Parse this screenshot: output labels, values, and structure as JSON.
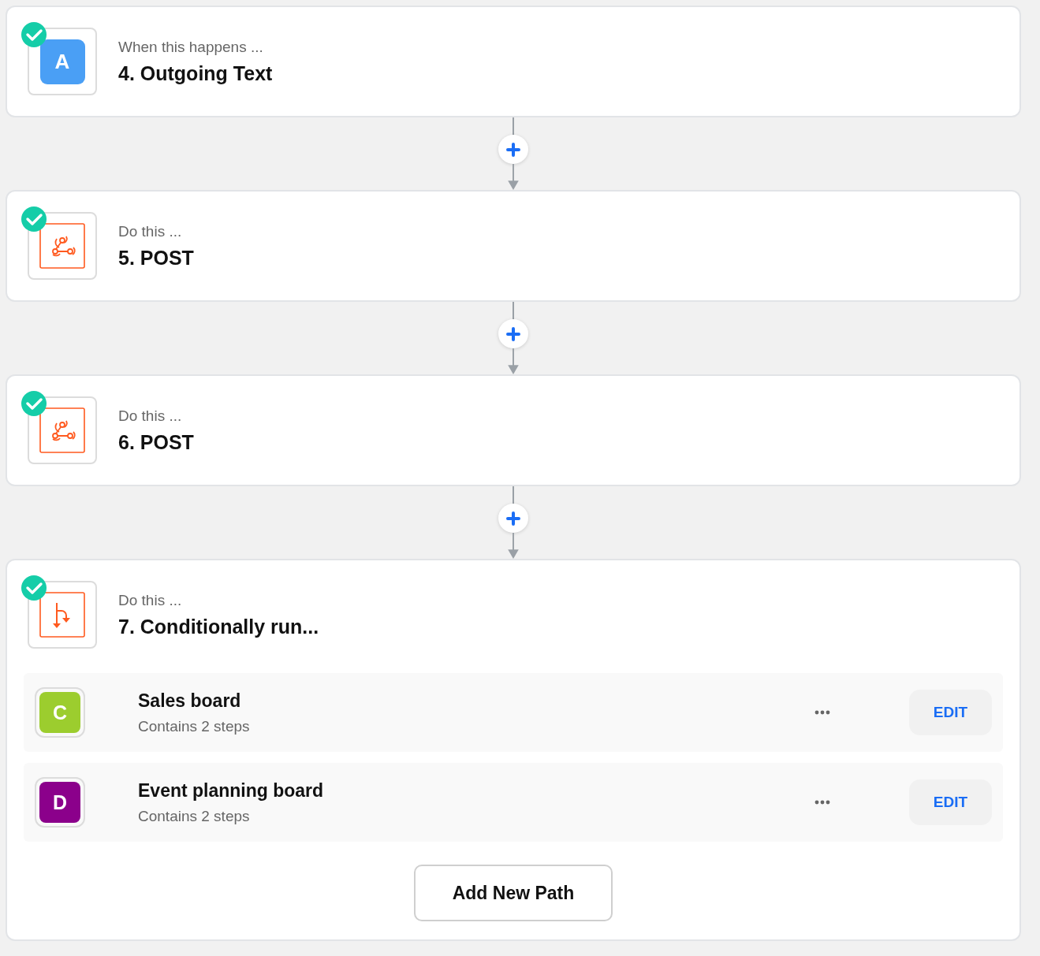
{
  "steps": [
    {
      "kind": "app",
      "done": true,
      "letter": "A",
      "color": "#4a9ff5",
      "label": "When this happens ...",
      "title": "4. Outgoing Text"
    },
    {
      "kind": "webhook",
      "done": true,
      "label": "Do this ...",
      "title": "5. POST"
    },
    {
      "kind": "webhook",
      "done": true,
      "label": "Do this ...",
      "title": "6. POST"
    },
    {
      "kind": "paths",
      "done": true,
      "label": "Do this ...",
      "title": "7. Conditionally run...",
      "paths": [
        {
          "letter": "C",
          "color": "#9ccd2e",
          "name": "Sales board",
          "detail": "Contains 2 steps",
          "edit": "EDIT"
        },
        {
          "letter": "D",
          "color": "#8b008b",
          "name": "Event planning board",
          "detail": "Contains 2 steps",
          "edit": "EDIT"
        }
      ],
      "add_button": "Add New Path"
    }
  ]
}
